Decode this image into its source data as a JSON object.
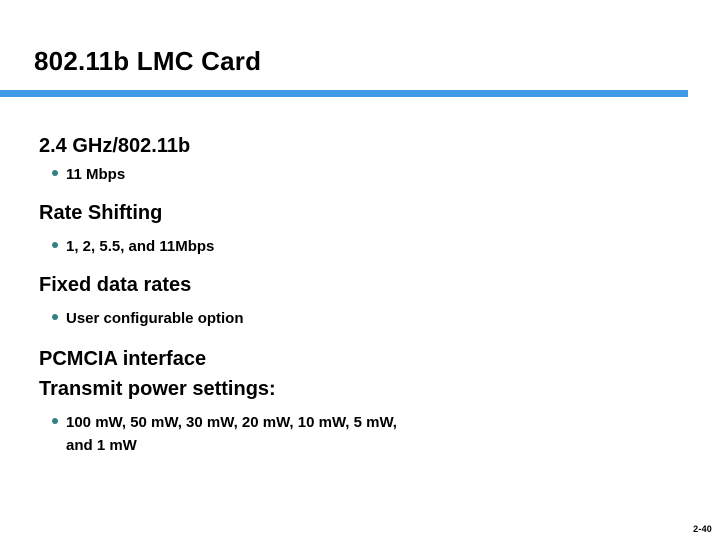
{
  "slide": {
    "title": "802.11b LMC Card",
    "accent_color": "#419ae8",
    "bullet_color": "#317f80",
    "page_number": "2-40",
    "blocks": [
      {
        "heading": "2.4 GHz/802.11b",
        "bullets": [
          "11 Mbps"
        ]
      },
      {
        "heading": "Rate Shifting",
        "bullets": [
          "1, 2, 5.5, and 11Mbps"
        ]
      },
      {
        "heading": "Fixed data rates",
        "bullets": [
          "User configurable option"
        ]
      },
      {
        "heading": "PCMCIA interface",
        "bullets": []
      },
      {
        "heading": "Transmit power settings:",
        "bullets": [
          "100 mW, 50 mW, 30 mW, 20 mW, 10 mW, 5 mW, and 1 mW"
        ]
      }
    ]
  }
}
